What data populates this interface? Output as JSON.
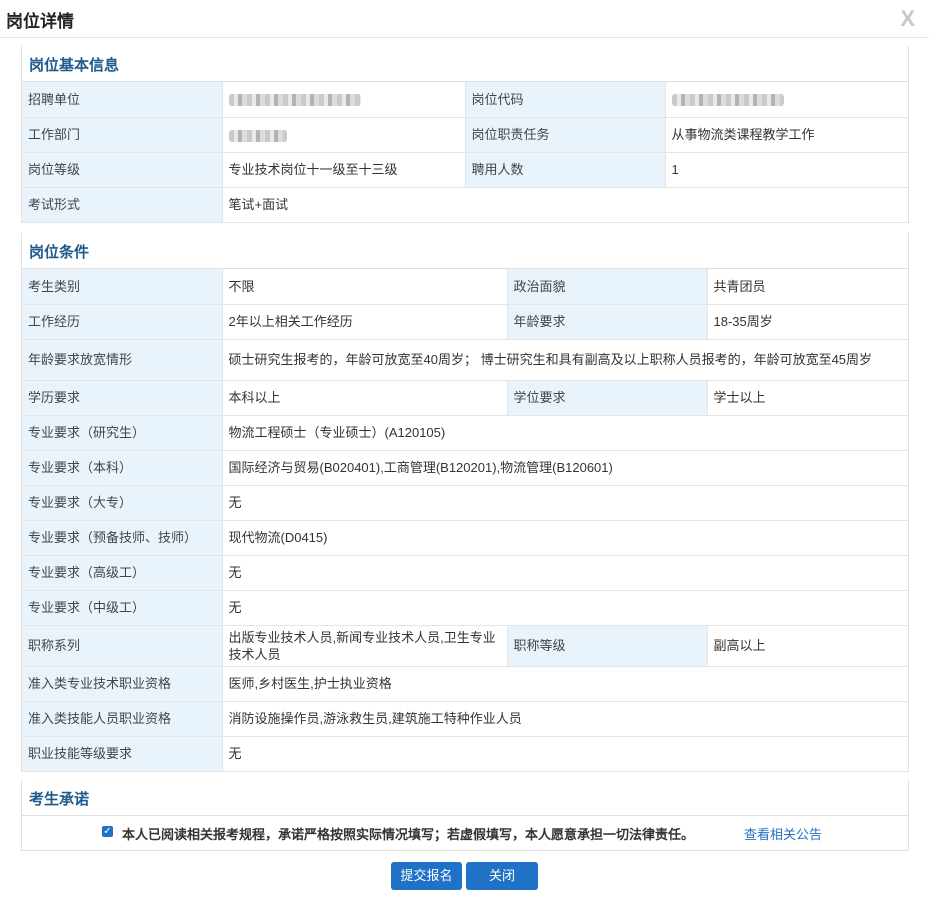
{
  "dialog": {
    "title": "岗位详情",
    "close_glyph": "X"
  },
  "basic": {
    "heading": "岗位基本信息",
    "unit_label": "招聘单位",
    "code_label": "岗位代码",
    "dept_label": "工作部门",
    "duty_label": "岗位职责任务",
    "duty_value": "从事物流类课程教学工作",
    "level_label": "岗位等级",
    "level_value": "专业技术岗位十一级至十三级",
    "count_label": "聘用人数",
    "count_value": "1",
    "exam_label": "考试形式",
    "exam_value": "笔试+面试"
  },
  "conditions": {
    "heading": "岗位条件",
    "rows": [
      {
        "label": "考生类别",
        "value": "不限",
        "label2": "政治面貌",
        "value2": "共青团员"
      },
      {
        "label": "工作经历",
        "value": "2年以上相关工作经历",
        "label2": "年龄要求",
        "value2": "18-35周岁"
      },
      {
        "label": "年龄要求放宽情形",
        "value": "硕士研究生报考的，年龄可放宽至40周岁；  博士研究生和具有副高及以上职称人员报考的，年龄可放宽至45周岁"
      },
      {
        "label": "学历要求",
        "value": "本科以上",
        "label2": "学位要求",
        "value2": "学士以上"
      },
      {
        "label": "专业要求（研究生）",
        "value": "物流工程硕士（专业硕士）(A120105)"
      },
      {
        "label": "专业要求（本科）",
        "value": "国际经济与贸易(B020401),工商管理(B120201),物流管理(B120601)"
      },
      {
        "label": "专业要求（大专）",
        "value": "无"
      },
      {
        "label": "专业要求（预备技师、技师）",
        "value": "现代物流(D0415)"
      },
      {
        "label": "专业要求（高级工）",
        "value": "无"
      },
      {
        "label": "专业要求（中级工）",
        "value": "无"
      },
      {
        "label": "职称系列",
        "value": "出版专业技术人员,新闻专业技术人员,卫生专业技术人员",
        "label2": "职称等级",
        "value2": "副高以上"
      },
      {
        "label": "准入类专业技术职业资格",
        "value": "医师,乡村医生,护士执业资格"
      },
      {
        "label": "准入类技能人员职业资格",
        "value": "消防设施操作员,游泳救生员,建筑施工特种作业人员"
      },
      {
        "label": "职业技能等级要求",
        "value": "无"
      }
    ]
  },
  "pledge": {
    "heading": "考生承诺",
    "checked": true,
    "text": "本人已阅读相关报考规程，承诺严格按照实际情况填写；若虚假填写，本人愿意承担一切法律责任。",
    "link": "查看相关公告"
  },
  "buttons": {
    "submit": "提交报名",
    "close": "关闭"
  },
  "colors": {
    "accent": "#1f72c6",
    "heading": "#1e5a8c",
    "label_bg": "#e9f3fb"
  }
}
